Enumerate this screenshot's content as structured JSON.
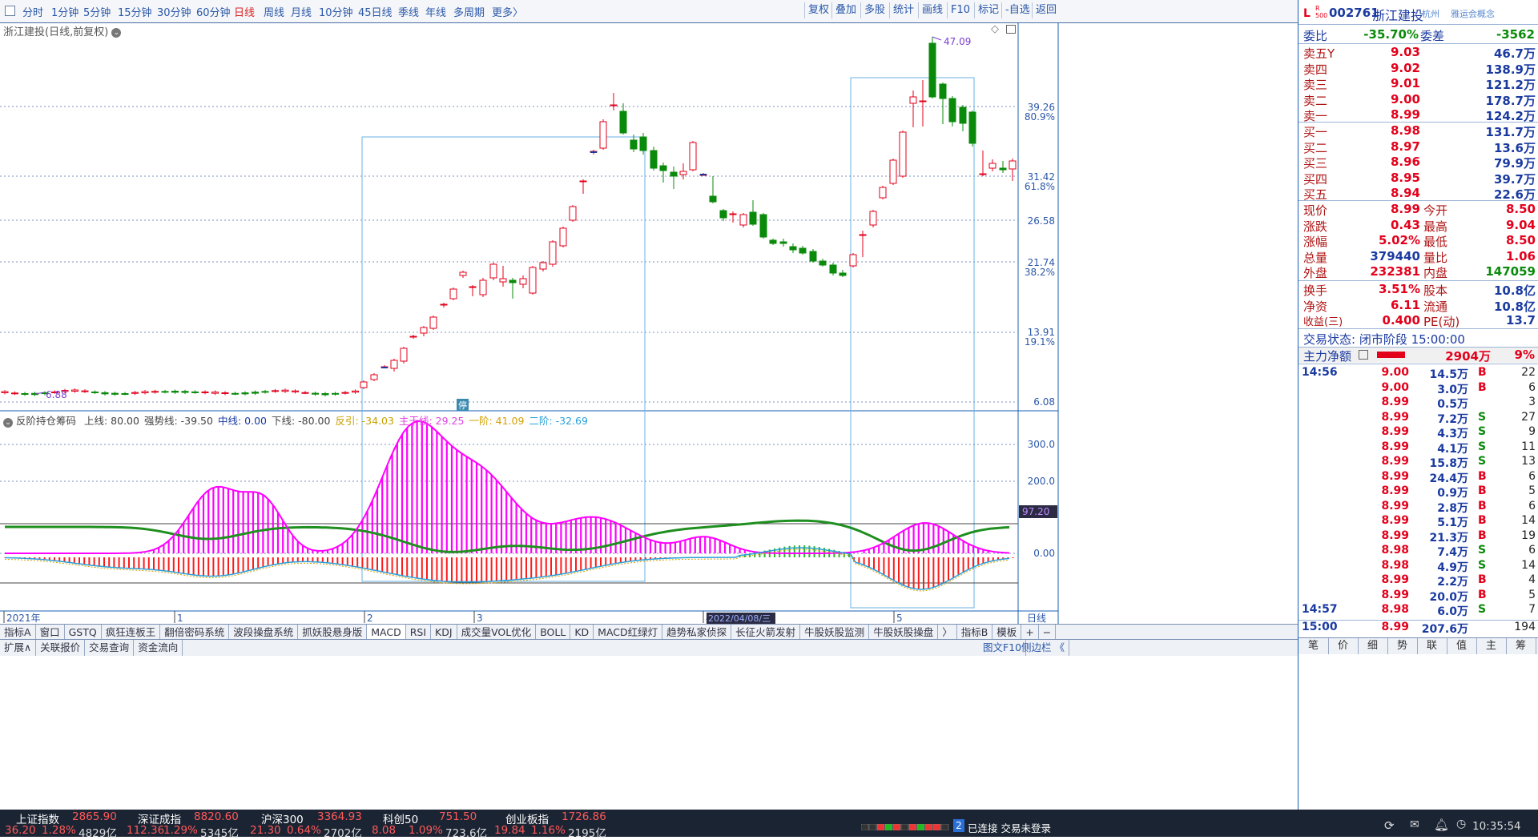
{
  "toolbar": {
    "left_items": [
      "分时",
      "1分钟",
      "5分钟",
      "15分钟",
      "30分钟",
      "60分钟",
      "日线",
      "周线",
      "月线",
      "10分钟",
      "45日线",
      "季线",
      "年线",
      "多周期",
      "更多〉"
    ],
    "active": "日线",
    "right_buttons": [
      "复权",
      "叠加",
      "多股",
      "统计",
      "画线",
      "F10",
      "标记",
      "-自选",
      "返回"
    ]
  },
  "chart": {
    "title": "浙江建投(日线,前复权)",
    "price_axis": [
      "39.26",
      "80.9%",
      "31.42",
      "61.8%",
      "26.58",
      "21.74",
      "38.2%",
      "13.91",
      "19.1%",
      "6.08"
    ],
    "high_label": "47.09",
    "low_label": "6.88",
    "stop_marker": "停",
    "x_labels": [
      "2021年",
      "1",
      "2",
      "3",
      "4",
      "5"
    ],
    "date_box": "2022/04/08/三",
    "period_label": "日线"
  },
  "indicator": {
    "name": "反阶持仓筹码",
    "params": [
      {
        "text": "上线: 80.00",
        "color": "#444"
      },
      {
        "text": "强势线: -39.50",
        "color": "#444"
      },
      {
        "text": "中线: 0.00",
        "color": "#1a3aa0"
      },
      {
        "text": "下线: -80.00",
        "color": "#444"
      },
      {
        "text": "反引: -34.03",
        "color": "#c8a000"
      },
      {
        "text": "主干线: 29.25",
        "color": "#e040e0"
      },
      {
        "text": "一阶: 41.09",
        "color": "#d4a000"
      },
      {
        "text": "二阶: -32.69",
        "color": "#2aa0d8"
      }
    ],
    "axis": [
      "300.0",
      "200.0",
      "0.00"
    ],
    "current_value": "97.20"
  },
  "tabs_row1": [
    "指标A",
    "窗口",
    "GSTQ",
    "疯狂连板王",
    "翻倍密码系统",
    "波段操盘系统",
    "抓妖股悬身版",
    "MACD",
    "RSI",
    "KDJ",
    "成交量VOL优化",
    "BOLL",
    "KD",
    "MACD红绿灯",
    "趋势私家侦探",
    "长征火箭发射",
    "牛股妖股监测",
    "牛股妖股操盘",
    "〉",
    "指标B",
    "模板",
    "+",
    "−"
  ],
  "tabs_row2": [
    "扩展∧",
    "关联报价",
    "交易查询",
    "资金流向"
  ],
  "tabs_row2_right": "图文F10",
  "tabs_row2_right2": "侧边栏 《",
  "quote": {
    "code": "002761",
    "name": "浙江建投",
    "region": "杭州",
    "concept": "雅运会概念",
    "weibi_label": "委比",
    "weibi": "-35.70%",
    "weicha_label": "委差",
    "weicha": "-3562",
    "sells": [
      {
        "label": "卖五Y",
        "price": "9.03",
        "vol": "46.7万"
      },
      {
        "label": "卖四",
        "price": "9.02",
        "vol": "138.9万"
      },
      {
        "label": "卖三",
        "price": "9.01",
        "vol": "121.2万"
      },
      {
        "label": "卖二",
        "price": "9.00",
        "vol": "178.7万"
      },
      {
        "label": "卖一",
        "price": "8.99",
        "vol": "124.2万"
      }
    ],
    "buys": [
      {
        "label": "买一",
        "price": "8.98",
        "vol": "131.7万"
      },
      {
        "label": "买二",
        "price": "8.97",
        "vol": "13.6万"
      },
      {
        "label": "买三",
        "price": "8.96",
        "vol": "79.9万"
      },
      {
        "label": "买四",
        "price": "8.95",
        "vol": "39.7万"
      },
      {
        "label": "买五",
        "price": "8.94",
        "vol": "22.6万"
      }
    ],
    "stats": [
      {
        "l1": "现价",
        "v1": "8.99",
        "l2": "今开",
        "v2": "8.50",
        "c1": "red",
        "c2": "red"
      },
      {
        "l1": "涨跌",
        "v1": "0.43",
        "l2": "最高",
        "v2": "9.04",
        "c1": "red",
        "c2": "red"
      },
      {
        "l1": "涨幅",
        "v1": "5.02%",
        "l2": "最低",
        "v2": "8.50",
        "c1": "red",
        "c2": "red"
      },
      {
        "l1": "总量",
        "v1": "379440",
        "l2": "量比",
        "v2": "1.06",
        "c1": "blue",
        "c2": "red"
      },
      {
        "l1": "外盘",
        "v1": "232381",
        "l2": "内盘",
        "v2": "147059",
        "c1": "red",
        "c2": "grn"
      }
    ],
    "stats2": [
      {
        "l1": "换手",
        "v1": "3.51%",
        "l2": "股本",
        "v2": "10.8亿"
      },
      {
        "l1": "净资",
        "v1": "6.11",
        "l2": "流通",
        "v2": "10.8亿"
      },
      {
        "l1": "收益(三)",
        "v1": "0.400",
        "l2": "PE(动)",
        "v2": "13.7"
      }
    ],
    "trade_status": "交易状态: 闭市阶段 15:00:00",
    "main_flow_label": "主力净额",
    "main_flow_value": "2904万",
    "main_flow_pct": "9%",
    "ticks": [
      {
        "t": "14:56",
        "p": "9.00",
        "v": "14.5万",
        "s": "B",
        "n": "22"
      },
      {
        "t": "",
        "p": "9.00",
        "v": "3.0万",
        "s": "B",
        "n": "6"
      },
      {
        "t": "",
        "p": "8.99",
        "v": "0.5万",
        "s": "",
        "n": "3"
      },
      {
        "t": "",
        "p": "8.99",
        "v": "7.2万",
        "s": "S",
        "n": "27"
      },
      {
        "t": "",
        "p": "8.99",
        "v": "4.3万",
        "s": "S",
        "n": "9"
      },
      {
        "t": "",
        "p": "8.99",
        "v": "4.1万",
        "s": "S",
        "n": "11"
      },
      {
        "t": "",
        "p": "8.99",
        "v": "15.8万",
        "s": "S",
        "n": "13"
      },
      {
        "t": "",
        "p": "8.99",
        "v": "24.4万",
        "s": "B",
        "n": "6"
      },
      {
        "t": "",
        "p": "8.99",
        "v": "0.9万",
        "s": "B",
        "n": "5"
      },
      {
        "t": "",
        "p": "8.99",
        "v": "2.8万",
        "s": "B",
        "n": "6"
      },
      {
        "t": "",
        "p": "8.99",
        "v": "5.1万",
        "s": "B",
        "n": "14"
      },
      {
        "t": "",
        "p": "8.99",
        "v": "21.3万",
        "s": "B",
        "n": "19"
      },
      {
        "t": "",
        "p": "8.98",
        "v": "7.4万",
        "s": "S",
        "n": "6"
      },
      {
        "t": "",
        "p": "8.98",
        "v": "4.9万",
        "s": "S",
        "n": "14"
      },
      {
        "t": "",
        "p": "8.99",
        "v": "2.2万",
        "s": "B",
        "n": "4"
      },
      {
        "t": "",
        "p": "8.99",
        "v": "20.0万",
        "s": "B",
        "n": "5"
      },
      {
        "t": "14:57",
        "p": "8.98",
        "v": "6.0万",
        "s": "S",
        "n": "7"
      },
      {
        "t": "15:00",
        "p": "8.99",
        "v": "207.6万",
        "s": "",
        "n": "194"
      }
    ],
    "bottom_tabs": [
      "笔",
      "价",
      "细",
      "势",
      "联",
      "值",
      "主",
      "筹"
    ]
  },
  "bottom": {
    "indices": [
      {
        "name": "上证指数",
        "value": "2865.90",
        "chg": "36.20",
        "pct": "1.28%",
        "amt": "4829亿"
      },
      {
        "name": "深证成指",
        "value": "8820.60",
        "chg": "112.36",
        "pct": "1.29%",
        "amt": "5345亿"
      },
      {
        "name": "沪深300",
        "value": "3364.93",
        "chg": "21.30",
        "pct": "0.64%",
        "amt": "2702亿"
      },
      {
        "name": "科创50",
        "value": "751.50",
        "chg": "8.08",
        "pct": "1.09%",
        "amt": "723.6亿"
      },
      {
        "name": "创业板指",
        "value": "1726.86",
        "chg": "19.84",
        "pct": "1.16%",
        "amt": "2195亿"
      }
    ],
    "conn_badge": "2",
    "conn_text": "已连接 交易未登录",
    "time": "10:35:54"
  }
}
